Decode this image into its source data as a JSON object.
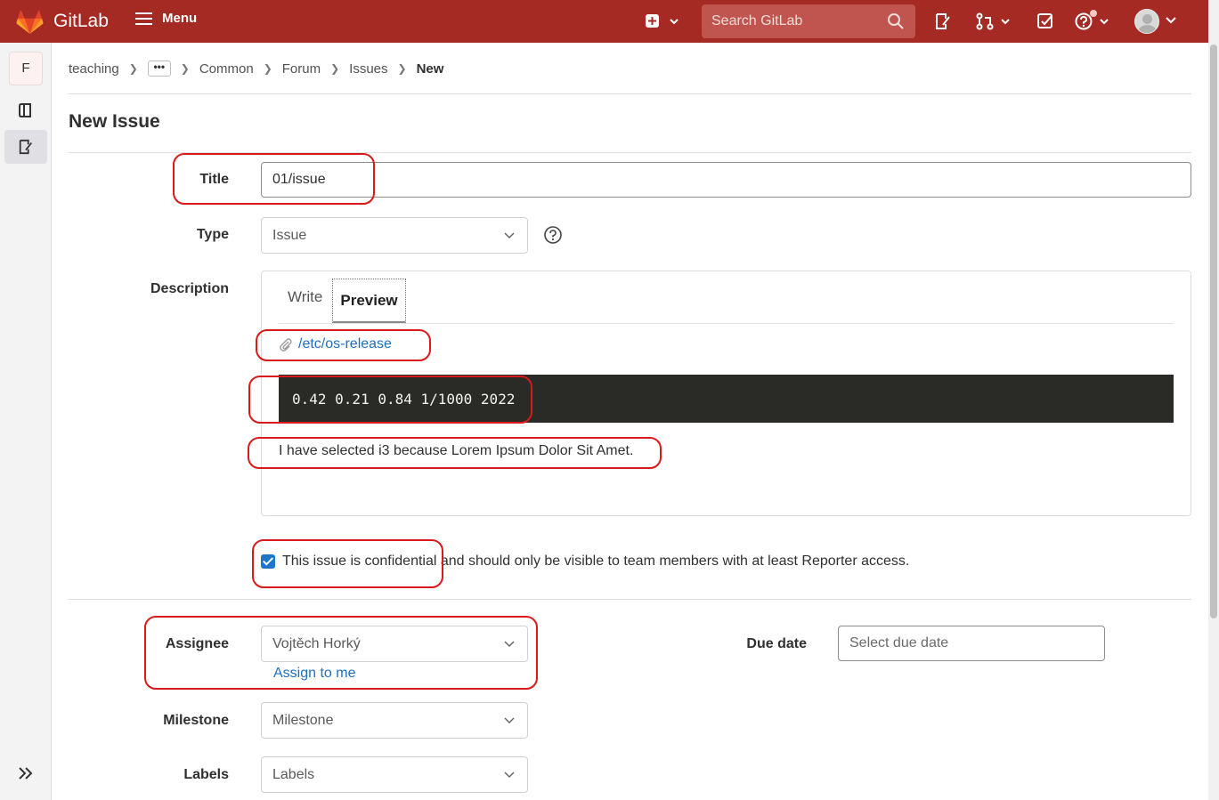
{
  "navbar": {
    "brand": "GitLab",
    "menu_label": "Menu",
    "search_placeholder": "Search GitLab"
  },
  "sidebar": {
    "project_initial": "F"
  },
  "breadcrumb": {
    "items": [
      "teaching",
      "•••",
      "Common",
      "Forum",
      "Issues",
      "New"
    ]
  },
  "page": {
    "title": "New Issue"
  },
  "form": {
    "title_label": "Title",
    "title_value": "01/issue",
    "type_label": "Type",
    "type_value": "Issue",
    "description_label": "Description",
    "tabs": [
      "Write",
      "Preview"
    ],
    "active_tab": "Preview",
    "preview": {
      "attachment_link": "/etc/os-release",
      "code": "0.42 0.21 0.84 1/1000 2022",
      "paragraph": "I have selected i3 because Lorem Ipsum Dolor Sit Amet."
    },
    "confidential_checked": true,
    "confidential_text": "This issue is confidential and should only be visible to team members with at least Reporter access.",
    "assignee_label": "Assignee",
    "assignee_value": "Vojtěch Horký",
    "assign_to_me": "Assign to me",
    "due_date_label": "Due date",
    "due_date_placeholder": "Select due date",
    "milestone_label": "Milestone",
    "milestone_value": "Milestone",
    "labels_label": "Labels",
    "labels_value": "Labels"
  },
  "colors": {
    "navbar": "#a62a24",
    "link": "#1f6fbf",
    "annotation": "#d91a1a"
  }
}
